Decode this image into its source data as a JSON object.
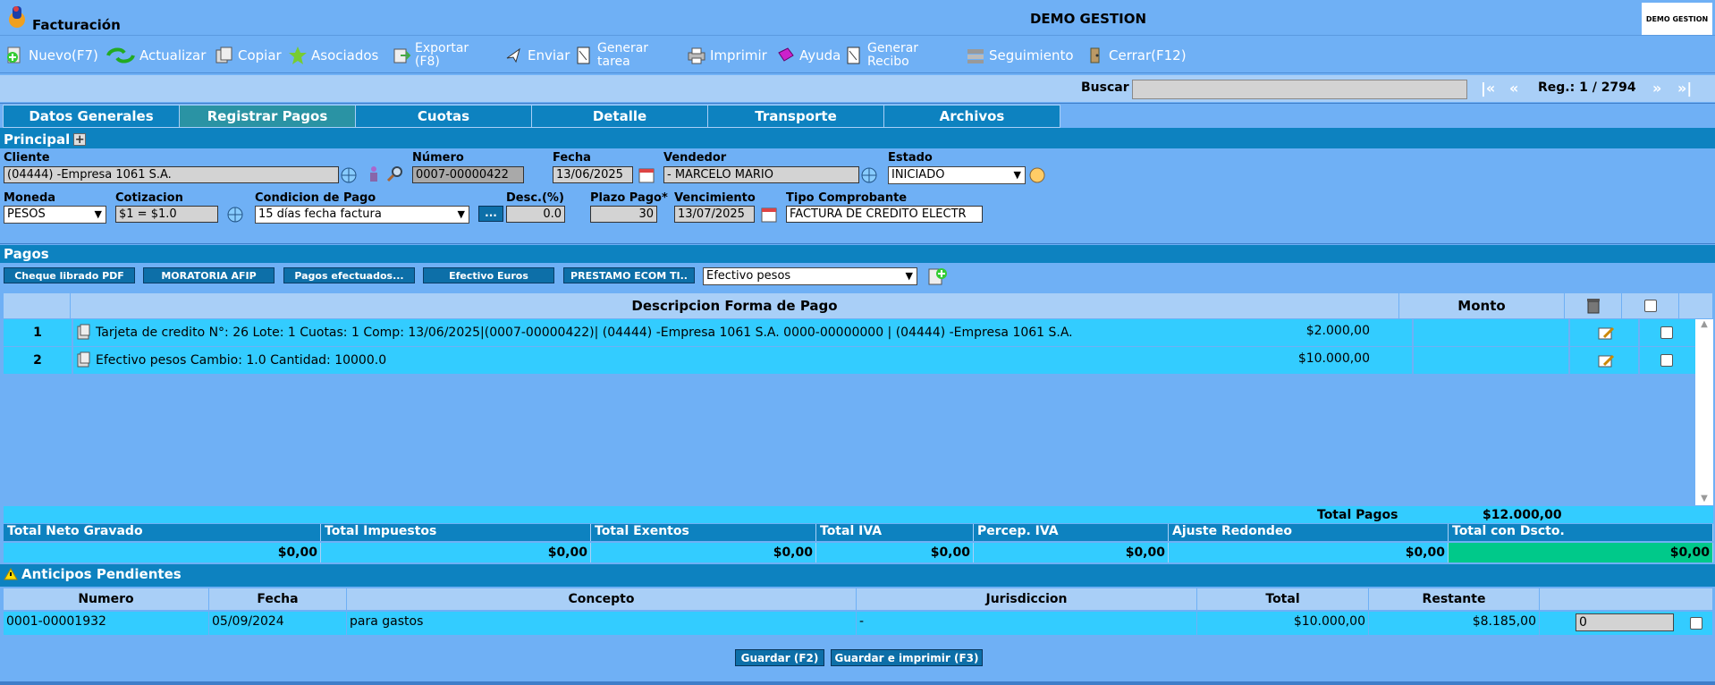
{
  "header": {
    "app_title": "Facturación",
    "center_title": "DEMO GESTION",
    "brand_box": "DEMO GESTION"
  },
  "toolbar": {
    "nuevo": "Nuevo(F7)",
    "actualizar": "Actualizar",
    "copiar": "Copiar",
    "asociados": "Asociados",
    "exportar_l1": "Exportar",
    "exportar_l2": "(F8)",
    "enviar": "Enviar",
    "generar_tarea_l1": "Generar",
    "generar_tarea_l2": "tarea",
    "imprimir": "Imprimir",
    "ayuda": "Ayuda",
    "generar_recibo_l1": "Generar",
    "generar_recibo_l2": "Recibo",
    "seguimiento": "Seguimiento",
    "cerrar": "Cerrar(F12)"
  },
  "search": {
    "label": "Buscar",
    "value": "",
    "first": "|«",
    "prev": "«",
    "reg_label": "Reg.: 1 / 2794",
    "next": "»",
    "last": "»|"
  },
  "tabs": [
    {
      "label": "Datos Generales",
      "active": false
    },
    {
      "label": "Registrar Pagos",
      "active": true
    },
    {
      "label": "Cuotas",
      "active": false
    },
    {
      "label": "Detalle",
      "active": false
    },
    {
      "label": "Transporte",
      "active": false
    },
    {
      "label": "Archivos",
      "active": false
    }
  ],
  "principal": {
    "section_title": "Principal",
    "cliente_label": "Cliente",
    "cliente_value": "(04444) -Empresa 1061 S.A.",
    "numero_label": "Número",
    "numero_value": "0007-00000422",
    "fecha_label": "Fecha",
    "fecha_value": "13/06/2025",
    "vendedor_label": "Vendedor",
    "vendedor_value": "- MARCELO MARIO",
    "estado_label": "Estado",
    "estado_value": "INICIADO",
    "moneda_label": "Moneda",
    "moneda_value": "PESOS",
    "cotizacion_label": "Cotizacion",
    "cotizacion_value": "$1 = $1.0",
    "condicion_label": "Condicion de Pago",
    "condicion_value": "15 días fecha factura",
    "ellipsis_button": "...",
    "desc_label": "Desc.(%)",
    "desc_value": "0.0",
    "plazo_label": "Plazo Pago*",
    "plazo_value": "30",
    "vencimiento_label": "Vencimiento",
    "vencimiento_value": "13/07/2025",
    "tipo_label": "Tipo Comprobante",
    "tipo_value": "FACTURA DE CREDITO ELECTR"
  },
  "pagos": {
    "section_title": "Pagos",
    "buttons": [
      "Cheque librado PDF",
      "MORATORIA AFIP",
      "Pagos efectuados...",
      "Efectivo Euros",
      "PRESTAMO ECOM TI.."
    ],
    "forma_select": "Efectivo pesos",
    "col_desc": "Descripcion Forma de Pago",
    "col_monto": "Monto",
    "rows": [
      {
        "num": "1",
        "desc": "Tarjeta de credito N°: 26 Lote: 1 Cuotas: 1 Comp: 13/06/2025|(0007-00000422)| (04444) -Empresa 1061 S.A. 0000-00000000 | (04444) -Empresa 1061 S.A.",
        "monto": "$2.000,00"
      },
      {
        "num": "2",
        "desc": "Efectivo pesos Cambio: 1.0 Cantidad: 10000.0",
        "monto": "$10.000,00"
      }
    ],
    "total_pagos_label": "Total Pagos",
    "total_pagos_value": "$12.000,00"
  },
  "totales": {
    "headers": [
      "Total Neto Gravado",
      "Total Impuestos",
      "Total Exentos",
      "Total IVA",
      "Percep. IVA",
      "Ajuste Redondeo",
      "Total con Dscto."
    ],
    "values": [
      "$0,00",
      "$0,00",
      "$0,00",
      "$0,00",
      "$0,00",
      "$0,00",
      "$0,00"
    ]
  },
  "anticipos": {
    "section_title": "Anticipos Pendientes",
    "headers": [
      "Numero",
      "Fecha",
      "Concepto",
      "Jurisdiccion",
      "Total",
      "Restante",
      ""
    ],
    "row": {
      "numero": "0001-00001932",
      "fecha": "05/09/2024",
      "concepto": "para gastos",
      "jurisdiccion": "-",
      "total": "$10.000,00",
      "restante": "$8.185,00",
      "input": "0"
    }
  },
  "footer": {
    "guardar": "Guardar (F2)",
    "guardar_imprimir": "Guardar e imprimir (F3)"
  },
  "colors": {
    "background": "#6fb0f5",
    "section_bar": "#0d82c0",
    "row_bg": "#33ccff",
    "total_highlight": "#00c98a"
  }
}
